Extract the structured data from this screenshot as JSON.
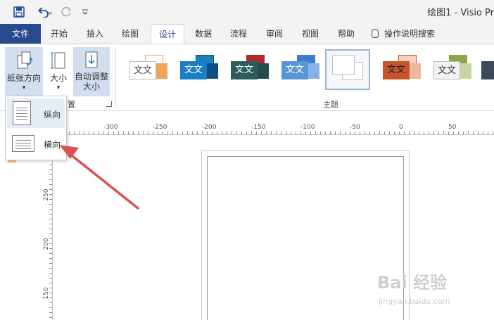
{
  "window": {
    "title": "绘图1  -  Visio Pr"
  },
  "qat": {
    "save_icon": "save-icon",
    "undo_icon": "undo-icon",
    "redo_icon": "redo-icon",
    "customize_icon": "customize-qat-icon"
  },
  "tabs": {
    "file": "文件",
    "items": [
      "开始",
      "插入",
      "绘图",
      "设计",
      "数据",
      "流程",
      "审阅",
      "视图",
      "帮助"
    ],
    "active": "设计",
    "tell_me": "操作说明搜索"
  },
  "ribbon": {
    "orientation_label": "纸张方向",
    "size_label": "大小",
    "autofit_label_1": "自动调整",
    "autofit_label_2": "大小",
    "page_setup_group_fragment": "置",
    "themes_group_label": "主题",
    "theme_sample_text": "文文",
    "theme_colors": [
      "#f2a45c",
      "#1b7ec2",
      "#b22a2a",
      "#3d7cc9",
      "#d8d8d8",
      "#c7532b",
      "#8aa64b",
      "#3a4a5a"
    ]
  },
  "dropdown": {
    "portrait_label": "纵向",
    "landscape_label": "横向"
  },
  "ruler": {
    "h_labels": [
      "-300",
      "-250",
      "-200",
      "-150",
      "-100",
      "-50",
      "0",
      "50"
    ],
    "v_labels": [
      "250",
      "200",
      "150"
    ]
  },
  "watermark": {
    "logo": "Bai 经验",
    "url": "jingyan.baidu.com"
  },
  "colors": {
    "accent": "#2a4a8e",
    "arrow": "#d9534f"
  }
}
